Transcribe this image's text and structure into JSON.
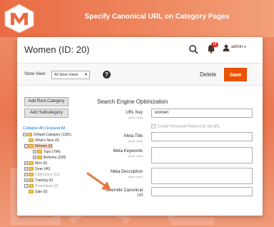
{
  "banner": {
    "title": "Specify Canonical URL on Category Pages",
    "logo_text": "ME"
  },
  "colors": {
    "accent": "#eb5202",
    "banner": "#e96b43",
    "link": "#007bdb",
    "arrow": "#e07a45"
  },
  "header": {
    "page_title": "Women (ID: 20)",
    "notification_count": "18",
    "user_label": "admin",
    "search_icon": "search-icon",
    "bell_icon": "bell-icon",
    "user_icon": "user-icon"
  },
  "toolbar": {
    "store_view_label": "Store View:",
    "store_view_value": "All Store Views",
    "help_label": "?",
    "delete_label": "Delete",
    "save_label": "Save"
  },
  "sidebar": {
    "add_root_label": "Add Root Category",
    "add_sub_label": "Add Subcategory",
    "collapse_label": "Collapse All",
    "separator": "|",
    "expand_label": "Expand All",
    "tree": [
      {
        "label": "Default Category (1181)"
      },
      {
        "label": "What's New (0)"
      },
      {
        "label": "Women (0)"
      },
      {
        "label": "Tops (784)"
      },
      {
        "label": "Bottoms (228)"
      },
      {
        "label": "Men (0)"
      },
      {
        "label": "Gear (46)"
      },
      {
        "label": "Collections (13)"
      },
      {
        "label": "Training (6)"
      },
      {
        "label": "Promotions (0)"
      },
      {
        "label": "Sale (0)"
      }
    ]
  },
  "form": {
    "section_title": "Search Engine Optimization",
    "scope_text": "[store view]",
    "url_key_label": "URL Key",
    "url_key_value": "women",
    "redirect_label": "Create Permanent Redirect for old URL",
    "redirect_check": "✓",
    "meta_title_label": "Meta Title",
    "meta_keywords_label": "Meta Keywords",
    "meta_description_label": "Meta Description",
    "canonical_label_line1": "Override Canonical",
    "canonical_label_line2": "Url"
  }
}
